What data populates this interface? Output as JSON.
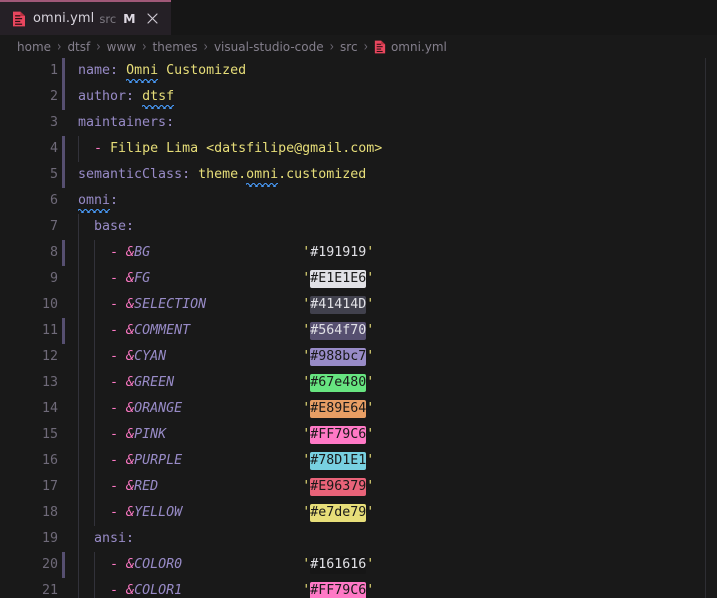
{
  "window": {
    "background": "#191919",
    "accent": "#a05878"
  },
  "tabbar": {
    "tabs": [
      {
        "icon": "yaml-file-icon",
        "label": "omni.yml",
        "description": "src",
        "dirty_indicator": "M",
        "close_icon": "close-icon",
        "active": true
      }
    ]
  },
  "breadcrumb": {
    "separator": "›",
    "items": [
      {
        "label": "home",
        "icon": null
      },
      {
        "label": "dtsf",
        "icon": null
      },
      {
        "label": "www",
        "icon": null
      },
      {
        "label": "themes",
        "icon": null
      },
      {
        "label": "visual-studio-code",
        "icon": null
      },
      {
        "label": "src",
        "icon": null
      },
      {
        "label": "omni.yml",
        "icon": "yaml-file-icon"
      }
    ]
  },
  "editor": {
    "language": "yaml",
    "gutter_modified_color": "#564f70",
    "indent_guide_color": "#32323a",
    "lines": [
      {
        "n": 1,
        "indent": 0,
        "modified": true,
        "type": "map",
        "key": "name",
        "value": "Omni Customized",
        "squiggle_word": "Omni"
      },
      {
        "n": 2,
        "indent": 0,
        "modified": true,
        "type": "map",
        "key": "author",
        "value": "dtsf",
        "squiggle_word": "dtsf"
      },
      {
        "n": 3,
        "indent": 0,
        "modified": false,
        "type": "map",
        "key": "maintainers",
        "value": ""
      },
      {
        "n": 4,
        "indent": 1,
        "modified": true,
        "type": "item",
        "value": "Filipe Lima <datsfilipe@gmail.com>"
      },
      {
        "n": 5,
        "indent": 0,
        "modified": true,
        "type": "map",
        "key": "semanticClass",
        "value": "theme.omni.customized",
        "squiggle_word": "omni"
      },
      {
        "n": 6,
        "indent": 0,
        "modified": false,
        "type": "map",
        "key": "omni",
        "value": "",
        "squiggle_word": "omni"
      },
      {
        "n": 7,
        "indent": 1,
        "modified": false,
        "type": "map",
        "key": "base",
        "value": ""
      },
      {
        "n": 8,
        "indent": 2,
        "modified": true,
        "type": "anchor",
        "anchor": "&BG",
        "value": "#191919",
        "swatch": "#191919",
        "swatch_text": "#E1E1E6"
      },
      {
        "n": 9,
        "indent": 2,
        "modified": false,
        "type": "anchor",
        "anchor": "&FG",
        "value": "#E1E1E6",
        "swatch": "#E1E1E6",
        "swatch_text": "#191919"
      },
      {
        "n": 10,
        "indent": 2,
        "modified": false,
        "type": "anchor",
        "anchor": "&SELECTION",
        "value": "#41414D",
        "swatch": "#41414D",
        "swatch_text": "#E1E1E6"
      },
      {
        "n": 11,
        "indent": 2,
        "modified": true,
        "type": "anchor",
        "anchor": "&COMMENT",
        "value": "#564f70",
        "swatch": "#564f70",
        "swatch_text": "#E1E1E6"
      },
      {
        "n": 12,
        "indent": 2,
        "modified": false,
        "type": "anchor",
        "anchor": "&CYAN",
        "value": "#988bc7",
        "swatch": "#988bc7",
        "swatch_text": "#191919"
      },
      {
        "n": 13,
        "indent": 2,
        "modified": false,
        "type": "anchor",
        "anchor": "&GREEN",
        "value": "#67e480",
        "swatch": "#67e480",
        "swatch_text": "#191919"
      },
      {
        "n": 14,
        "indent": 2,
        "modified": false,
        "type": "anchor",
        "anchor": "&ORANGE",
        "value": "#E89E64",
        "swatch": "#E89E64",
        "swatch_text": "#191919"
      },
      {
        "n": 15,
        "indent": 2,
        "modified": false,
        "type": "anchor",
        "anchor": "&PINK",
        "value": "#FF79C6",
        "swatch": "#FF79C6",
        "swatch_text": "#191919"
      },
      {
        "n": 16,
        "indent": 2,
        "modified": false,
        "type": "anchor",
        "anchor": "&PURPLE",
        "value": "#78D1E1",
        "swatch": "#78D1E1",
        "swatch_text": "#191919"
      },
      {
        "n": 17,
        "indent": 2,
        "modified": false,
        "type": "anchor",
        "anchor": "&RED",
        "value": "#E96379",
        "swatch": "#E96379",
        "swatch_text": "#191919"
      },
      {
        "n": 18,
        "indent": 2,
        "modified": false,
        "type": "anchor",
        "anchor": "&YELLOW",
        "value": "#e7de79",
        "swatch": "#e7de79",
        "swatch_text": "#191919"
      },
      {
        "n": 19,
        "indent": 1,
        "modified": false,
        "type": "map",
        "key": "ansi",
        "value": ""
      },
      {
        "n": 20,
        "indent": 2,
        "modified": true,
        "type": "anchor",
        "anchor": "&COLOR0",
        "value": "#161616",
        "swatch": "#161616",
        "swatch_text": "#E1E1E6"
      },
      {
        "n": 21,
        "indent": 2,
        "modified": false,
        "type": "anchor",
        "anchor": "&COLOR1",
        "value": "#FF79C6",
        "swatch": "#FF79C6",
        "swatch_text": "#191919"
      }
    ]
  }
}
